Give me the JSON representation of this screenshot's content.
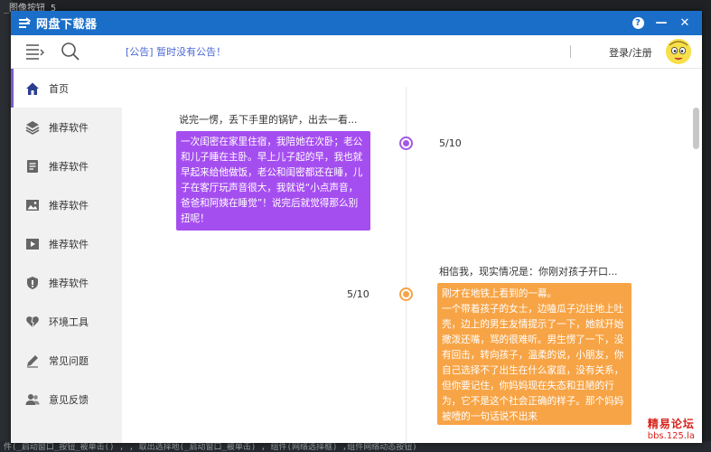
{
  "background": {
    "top_text": "_图像按钮     5",
    "bottom_text": "件(_启动窗口_按钮_被单击() ,  , 取出选择地(_启动窗口_被单击) , 组件(网络选择框) ,组件网络动态按钮)"
  },
  "window": {
    "title": "网盘下载器",
    "help_label": "?",
    "minimize_label": "—",
    "close_label": "✕"
  },
  "toolbar": {
    "notice": "[公告] 暂时没有公告！",
    "login": "登录/注册"
  },
  "sidebar": {
    "items": [
      {
        "label": "首页",
        "icon": "home-icon",
        "active": true
      },
      {
        "label": "推荐软件",
        "icon": "layers-icon"
      },
      {
        "label": "推荐软件",
        "icon": "document-icon"
      },
      {
        "label": "推荐软件",
        "icon": "image-icon"
      },
      {
        "label": "推荐软件",
        "icon": "play-icon"
      },
      {
        "label": "推荐软件",
        "icon": "shield-icon"
      },
      {
        "label": "环境工具",
        "icon": "heart-icon"
      },
      {
        "label": "常见问题",
        "icon": "edit-icon"
      },
      {
        "label": "意见反馈",
        "icon": "users-icon"
      }
    ]
  },
  "timeline": {
    "entries": [
      {
        "title": "说完一愣，丢下手里的锅铲，出去一看...",
        "body": "一次闺密在家里住宿，我陪她在次卧；老公和儿子睡在主卧。早上儿子起的早，我也就早起来给他做饭，老公和闺密都还在睡，儿子在客厅玩声音很大，我就说“小点声音，爸爸和阿姨在睡觉”！说完后就觉得那么别扭呢！",
        "page": "5/10",
        "color": "#a54ef0"
      },
      {
        "title": "相信我，现实情况是：你刚对孩子开口...",
        "body": "刚才在地铁上看到的一幕。\n一个带着孩子的女士，边嗑瓜子边往地上吐壳，边上的男生友情提示了一下，她就开始撒泼还嘴，骂的很难听。男生愣了一下，没有回击，转向孩子，温柔的说，小朋友，你自己选择不了出生在什么家庭，没有关系，但你要记住，你妈妈现在失态和丑陋的行为，它不是这个社会正确的样子。那个妈妈被噎的一句话说不出来",
        "page": "5/10",
        "color": "#f7a446"
      }
    ]
  },
  "watermark": {
    "line1": "精易论坛",
    "line2": "bbs.125.la"
  }
}
